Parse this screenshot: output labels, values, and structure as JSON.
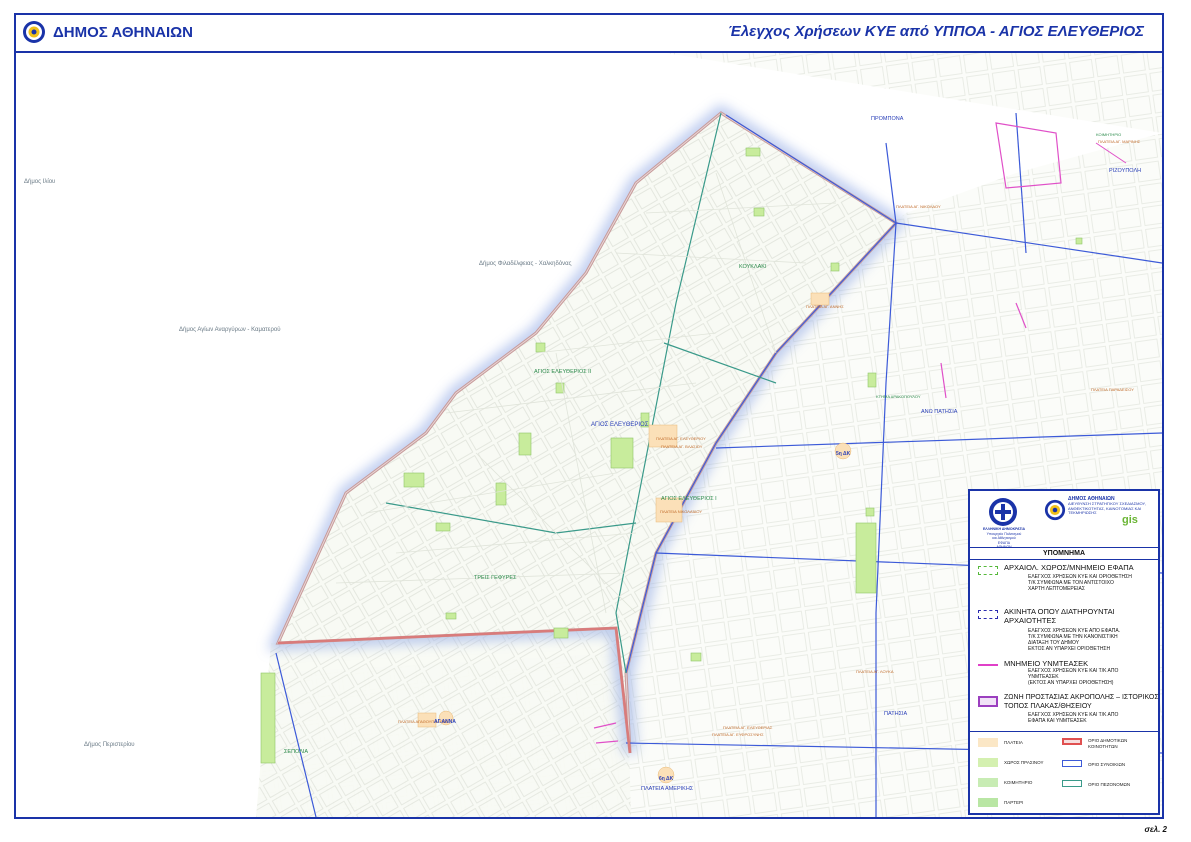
{
  "header": {
    "dept_name": "ΔΗΜΟΣ ΑΘΗΝΑΙΩΝ",
    "map_title": "Έλεγχος Χρήσεων ΚΥΕ από ΥΠΠΟΑ - ΑΓΙΟΣ ΕΛΕΥΘΕΡΙΟΣ"
  },
  "footer": {
    "page_number": "σελ. 2"
  },
  "map_labels": {
    "dimos_iliou": "Δήμος Ιλίου",
    "dimos_filadelfeias": "Δήμος Φιλαδέλφειας - Χαλκηδόνας",
    "dimos_agion_anargyron": "Δήμος Αγίων Αναργύρων - Καματερού",
    "dimos_peristeriou": "Δήμος Περιστερίου",
    "agios_eleftherios": "ΑΓΙΟΣ ΕΛΕΥΘΕΡΙΟΣ",
    "agios_eleftherios_ii": "ΑΓΙΟΣ ΕΛΕΥΘΕΡΙΟΣ ΙΙ",
    "agios_eleftherios_i": "ΑΓΙΟΣ ΕΛΕΥΘΕΡΙΟΣ Ι",
    "koukliki": "ΚΟΥΚΛΑΚΙ",
    "treis_gefyres": "ΤΡΕΙΣ ΓΕΦΥΡΕΣ",
    "prompona": "ΠΡΟΜΠΟΝΑ",
    "rizoupoli": "ΡΙΖΟΥΠΟΛΗ",
    "ano_patisia": "ΑΝΩ ΠΑΤΗΣΙΑ",
    "patisia": "ΠΑΤΗΣΙΑ",
    "sepolia": "ΣΕΠΟΛΙΑ",
    "plateia_amerikis": "ΠΛΑΤΕΙΑ ΑΜΕΡΙΚΗΣ",
    "dk5": "5η ΔΚ",
    "dk6": "6η ΔΚ",
    "koimitirio": "ΚΟΙΜΗΤΗΡΙΟ",
    "ktima_drakopoulou": "ΚΤΗΜΑ ΔΡΑΚΟΠΟΥΛΟΥ",
    "plateia_ag_eleftheriou": "ΠΛΑΤΕΙΑ ΑΓ. ΕΛΕΥΘΕΡΙΟΥ",
    "plateia_nikolaidou": "ΠΛΑΤΕΙΑ ΝΙΚΟΛΑΪΔΟΥ",
    "plateia_ag_loukas": "ΠΛΑΤΕΙΑ ΑΓ. ΛΟΥΚΑ",
    "plateia_ag_eleftherias": "ΠΛΑΤΕΙΑ ΑΓ. ΕΛΕΥΘΕΡΙΑΣ",
    "plateia_paradeisou": "ΠΛΑΤΕΙΑ ΠΑΡΑΔΕΙΣΟΥ",
    "plateia_agiou_nikolaou": "ΠΛΑΤΕΙΑ ΑΓ. ΝΙΚΟΛΑΟΥ",
    "plateia_agathoupoleos": "ΠΛΑΤΕΙΑ ΑΓΑΘΟΥΠΟΛΕΩΣ",
    "plateia_ag_marinis": "ΠΛΑΤΕΙΑ ΑΓ. ΜΑΡΙΝΗΣ",
    "plateia_ag_annis": "ΠΛΑΤΕΙΑ ΑΓ. ΑΝΝΗΣ",
    "plateia_amerikis_small": "ΠΛΑΤΕΙΑ ΑΓ. ΕΥΦΡΟΣΥΝΗΣ",
    "plateia_kypselis": "ΠΛΑΤΕΙΑ ΑΓ. ΒΛΑΣΙΟΥ",
    "ag_anna": "ΑΓ.ΑΝΝΑ"
  },
  "legend": {
    "org_name": "ΕΛΛΗΝΙΚΗ ΔΗΜΟΚΡΑΤΙΑ",
    "org_sub1": "Υπουργείο Πολιτισμού",
    "org_sub2": "και Αθλητισμού",
    "org_sub3": "ΕΦΑΠΑ",
    "org_sub4": "ΑΘΗΝΩΝ",
    "ath_name": "ΔΗΜΟΣ ΑΘΗΝΑΙΩΝ",
    "ath_sub": "ΔΙΕΥΘΥΝΣΗ ΣΤΡΑΤΗΓΙΚΟΥ ΣΧΕΔΙΑΣΜΟΥ, ΑΝΘΕΚΤΙΚΟΤΗΤΑΣ, ΚΑΙΝΟΤΟΜΙΑΣ ΚΑΙ ΤΕΚΜΗΡΙΩΣΗΣ",
    "gis": "gis",
    "title": "ΥΠΟΜΝΗΜΑ",
    "items": [
      {
        "title": "ΑΡΧΑΙΟΛ. ΧΩΡΟΣ/ΜΝΗΜΕΙΟ ΕΦΑΠΑ",
        "lines": [
          "ΕΛΕΓΧΟΣ ΧΡΗΣΕΩΝ ΚΥΕ ΚΑΙ ΟΡΙΟΘΕΤΗΣΗ",
          "Τ/Κ ΣΥΜΦΩΝΑ ΜΕ ΤΟΝ ΑΝΤΙΣΤΟΙΧΟ",
          "ΧΑΡΤΗ ΛΕΠΤΟΜΕΡΕΙΑΣ"
        ],
        "color": "#55b83a"
      },
      {
        "title": "ΑΚΙΝΗΤΑ ΟΠΟΥ ΔΙΑΤΗΡΟΥΝΤΑΙ ΑΡΧΑΙΟΤΗΤΕΣ",
        "lines": [
          "ΕΛΕΓΧΟΣ ΧΡΗΣΕΩΝ ΚΥΕ ΑΠΟ ΕΦΑΠΑ.",
          "Τ/Κ ΣΥΜΦΩΝΑ ΜΕ ΤΗΝ ΚΑΝΟΝΙΣΤΙΚΗ",
          "ΔΙΑΤΑΞΗ ΤΟΥ ΔΗΜΟΥ",
          "ΕΚΤΟΣ ΑΝ ΥΠΑΡΧΕΙ ΟΡΙΟΘΕΤΗΣΗ"
        ],
        "color": "#2a2ab0"
      },
      {
        "title": "ΜΝΗΜΕΙΟ ΥΝΜΤΕΑΣΕΚ",
        "lines": [
          "ΕΛΕΓΧΟΣ ΧΡΗΣΕΩΝ ΚΥΕ ΚΑΙ Τ/Κ ΑΠΟ",
          "ΥΝΜΤΕΑΣΕΚ",
          "(ΕΚΤΟΣ ΑΝ ΥΠΑΡΧΕΙ ΟΡΙΟΘΕΤΗΣΗ)"
        ],
        "color": "#e040c8"
      },
      {
        "title": "ΖΩΝΗ ΠΡΟΣΤΑΣΙΑΣ ΑΚΡΟΠΟΛΗΣ – ΙΣΤΟΡΙΚΟΣ ΤΟΠΟΣ ΠΛΑΚΑΣ/ΘΗΣΕΙΟΥ",
        "lines": [
          "ΕΛΕΓΧΟΣ ΧΡΗΣΕΩΝ ΚΥΕ ΚΑΙ Τ/Κ ΑΠΟ",
          "ΕΦΑΠΑ ΚΑΙ ΥΝΜΤΕΑΣΕΚ"
        ],
        "color": "#9b3fbf"
      }
    ],
    "small_items": {
      "plateia": "ΠΛΑΤΕΙΑ",
      "xoros_prasinou": "ΧΩΡΟΣ ΠΡΑΣΙΝΟΥ",
      "koimitirio": "ΚΟΙΜΗΤΗΡΙΟ",
      "parteri": "ΠΑΡΤΕΡΙ",
      "orio_koinotiton": "ΟΡΙΟ ΔΗΜΟΤΙΚΩΝ ΚΟΙΝΟΤΗΤΩΝ",
      "orio_synoikion": "ΟΡΙΟ ΣΥΝΟΙΚΙΩΝ",
      "orio_pezodromon": "ΟΡΙΟ ΠΕΖΟΝΟΜΩΝ"
    },
    "colors": {
      "plateia": "#fbe7c6",
      "xoros_prasinou": "#d4f0b0",
      "koimitirio": "#c8ecb4",
      "parteri": "#b9e6a4",
      "orio_koinotiton": "#e05050",
      "orio_synoikion": "#3c5ad8",
      "orio_pezodromon": "#3a9a8a"
    }
  }
}
